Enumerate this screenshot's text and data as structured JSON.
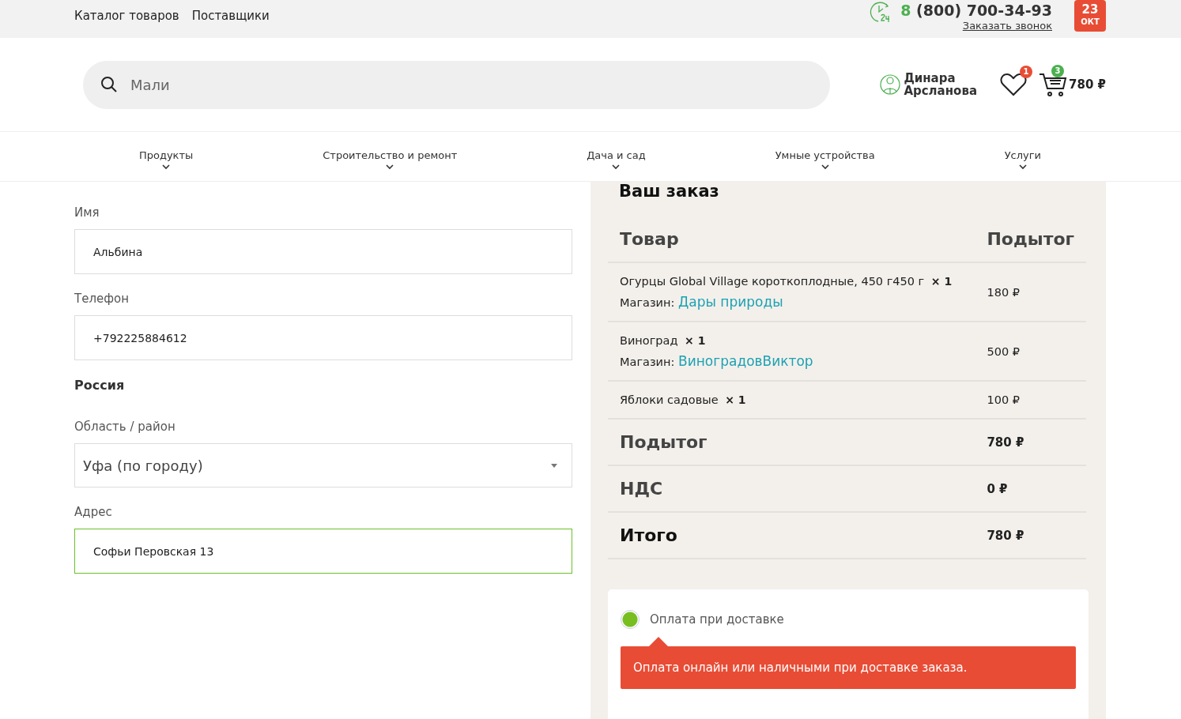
{
  "top_bar": {
    "links": [
      "Каталог товаров",
      "Поставщики"
    ],
    "phone_prefix": "8",
    "phone": "(800) 700-34-93",
    "callback_link": "Заказать звонок",
    "date": {
      "day": "23",
      "month": "ОКТ"
    }
  },
  "header": {
    "search": {
      "value": "Мали"
    },
    "user": {
      "first_name": "Динара",
      "last_name": "Арсланова"
    },
    "favorites_count": "1",
    "cart_count": "3",
    "cart_total": "780 ₽"
  },
  "nav": [
    "Продукты",
    "Строительство и ремонт",
    "Дача и сад",
    "Умные устройства",
    "Услуги"
  ],
  "form": [
    {
      "kind": "input",
      "label": "Имя",
      "value": "Альбина",
      "focused": false
    },
    {
      "kind": "input",
      "label": "Телефон",
      "value": "+792225884612",
      "focused": false
    },
    {
      "kind": "static",
      "value": "Россия"
    },
    {
      "kind": "select",
      "label": "Область / район",
      "value": "Уфа (по городу)"
    },
    {
      "kind": "input",
      "label": "Адрес",
      "value": "Софьи Перовская 13",
      "focused": true
    }
  ],
  "order": {
    "title": "Ваш заказ",
    "columns": [
      "Товар",
      "Подытог"
    ],
    "items": [
      {
        "name": "Огурцы Global Village короткоплодные, 450 г450 г",
        "qty": "× 1",
        "store_label": "Магазин:",
        "store": "Дары природы",
        "price": "180 ₽"
      },
      {
        "name": "Виноград",
        "qty": "× 1",
        "store_label": "Магазин:",
        "store": "ВиноградовВиктор",
        "price": "500 ₽"
      },
      {
        "name": "Яблоки садовые",
        "qty": "× 1",
        "price": "100 ₽"
      }
    ],
    "totals": [
      {
        "label": "Подытог",
        "value": "780 ₽",
        "grand": false
      },
      {
        "label": "НДС",
        "value": "0 ₽",
        "grand": false
      },
      {
        "label": "Итого",
        "value": "780 ₽",
        "grand": true
      }
    ]
  },
  "payment": {
    "options": [
      {
        "label": "Оплата при доставке",
        "selected": true
      }
    ],
    "note": "Оплата онлайн или наличными при доставке заказа."
  }
}
